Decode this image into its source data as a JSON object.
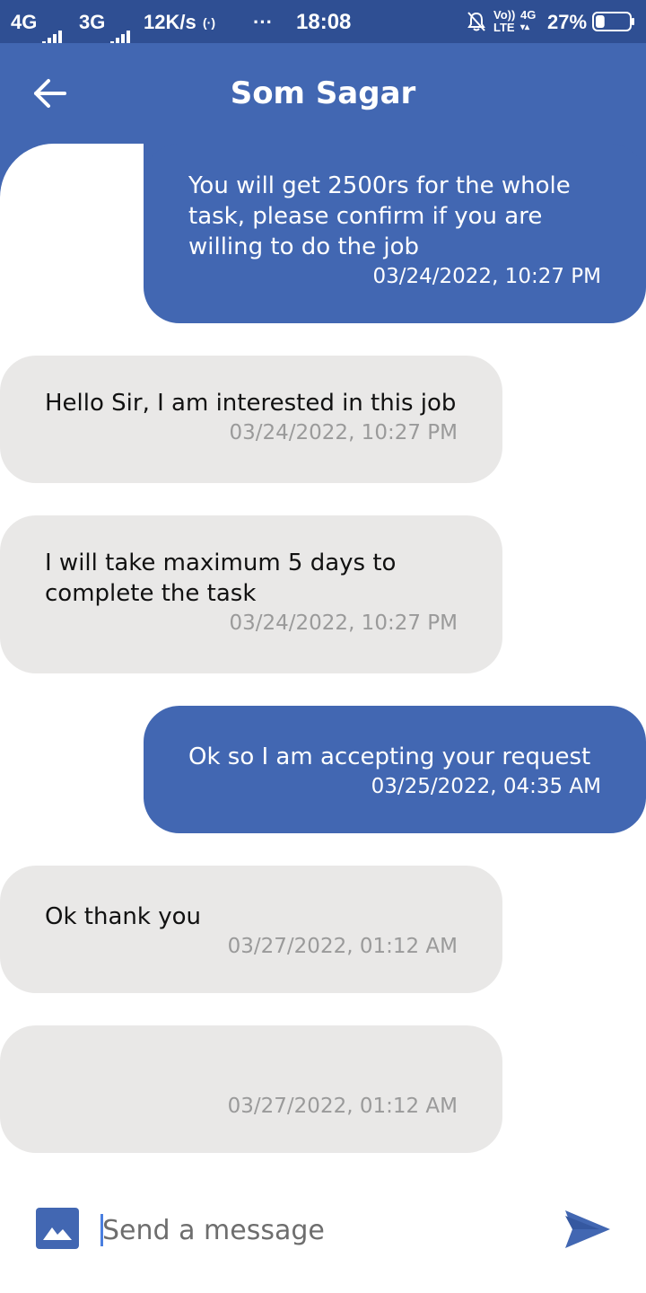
{
  "status_bar": {
    "left_network_1": "4G",
    "left_network_2": "3G",
    "speed": "12K/s",
    "hotspot_icon": "hotspot-icon",
    "more": "···",
    "time": "18:08",
    "volte_top": "Vo))",
    "volte_bottom": "LTE",
    "network_4g": "4G",
    "battery_percent": "27%",
    "battery_level": 0.27
  },
  "header": {
    "title": "Som Sagar",
    "back_icon": "back-arrow-icon",
    "color": "#4267b2"
  },
  "messages": [
    {
      "direction": "sent",
      "text": "You will get 2500rs for the whole task, please confirm if you are willing to do the job",
      "time": "03/24/2022, 10:27 PM"
    },
    {
      "direction": "received",
      "text": "Hello Sir, I am interested in this job",
      "time": "03/24/2022, 10:27 PM"
    },
    {
      "direction": "received",
      "text": "I will take maximum 5 days to complete the task",
      "time": "03/24/2022, 10:27 PM"
    },
    {
      "direction": "sent",
      "text": "Ok so I am accepting your request",
      "time": "03/25/2022, 04:35 AM"
    },
    {
      "direction": "received",
      "text": "Ok thank you",
      "time": "03/27/2022, 01:12 AM"
    },
    {
      "direction": "received",
      "text": "",
      "time": "03/27/2022, 01:12 AM"
    }
  ],
  "composer": {
    "placeholder": "Send a message",
    "attach_icon": "image-icon",
    "send_icon": "send-icon"
  },
  "colors": {
    "sent_bubble": "#4267b2",
    "received_bubble": "#e9e8e7",
    "status_bar": "#2f4f93"
  }
}
